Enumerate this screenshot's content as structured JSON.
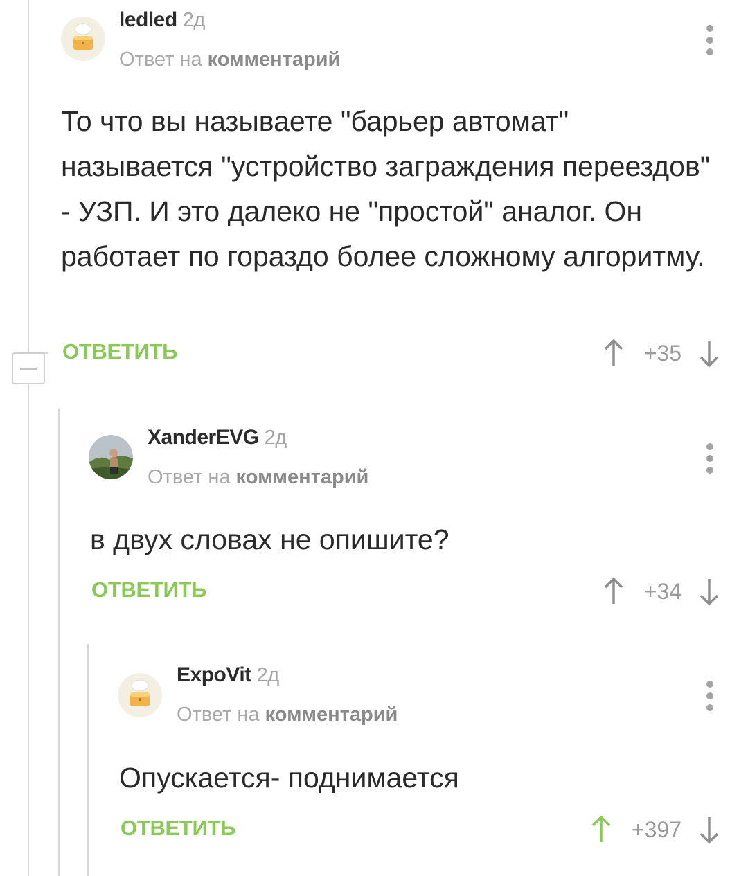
{
  "comments": [
    {
      "author": "ledled",
      "time": "2д",
      "reply_prefix": "Ответ на",
      "reply_target": "комментарий",
      "text": "То что вы называете \"барьер автомат\" называется \"устройство заграждения переездов\" - УЗП. И это далеко не \"простой\" аналог. Он работает по гораздо более сложному алгоритму.",
      "reply_label": "ОТВЕТИТЬ",
      "score": "+35",
      "upvote_active": false
    },
    {
      "author": "XanderEVG",
      "time": "2д",
      "reply_prefix": "Ответ на",
      "reply_target": "комментарий",
      "text": "в двух словах не опишите?",
      "reply_label": "ОТВЕТИТЬ",
      "score": "+34",
      "upvote_active": false
    },
    {
      "author": "ExpoVit",
      "time": "2д",
      "reply_prefix": "Ответ на",
      "reply_target": "комментарий",
      "text": "Опускается- поднимается",
      "reply_label": "ОТВЕТИТЬ",
      "score": "+397",
      "upvote_active": true
    }
  ],
  "colors": {
    "accent_green": "#8ac858",
    "muted": "#a3a3a3",
    "thread_line": "#d7d7d7"
  },
  "icons": [
    "cake-avatar-icon",
    "photo-avatar",
    "more-vertical-icon",
    "arrow-up-icon",
    "arrow-down-icon",
    "collapse-minus-icon"
  ]
}
